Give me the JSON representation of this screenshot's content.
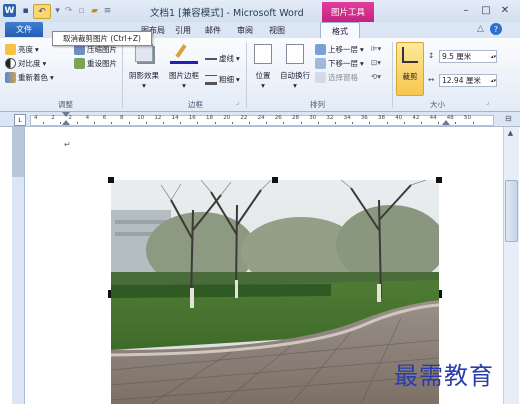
{
  "titlebar": {
    "title": "文档1 [兼容模式] - Microsoft Word",
    "context_group": "图片工具",
    "app_icon": "W"
  },
  "tabs": {
    "file": "文件",
    "items": [
      "图布局",
      "引用",
      "邮件",
      "审阅",
      "视图"
    ],
    "format": "格式"
  },
  "tooltip": "取消裁剪图片 (Ctrl+Z)",
  "ribbon": {
    "adjust": {
      "brightness": "亮度",
      "contrast": "对比度",
      "recolor": "重新着色",
      "compress": "压缩图片",
      "reset": "重设图片",
      "label": "调整"
    },
    "styles": {
      "shadow": "阴影效果",
      "border": "图片边框",
      "dashes": "虚线",
      "weight": "粗细",
      "label": "边框"
    },
    "arrange": {
      "position": "位置",
      "wrap": "自动换行",
      "bring_forward": "上移一层",
      "send_backward": "下移一层",
      "selection_pane": "选择窗格",
      "label": "排列"
    },
    "size": {
      "crop": "裁剪",
      "height": "9.5 厘米",
      "width": "12.94 厘米",
      "label": "大小"
    }
  },
  "ruler": {
    "numbers": [
      "4",
      "2",
      "2",
      "4",
      "6",
      "8",
      "10",
      "12",
      "14",
      "16",
      "18",
      "20",
      "22",
      "24",
      "26",
      "28",
      "30",
      "32",
      "34",
      "36",
      "38",
      "40",
      "42",
      "44",
      "48",
      "50"
    ]
  },
  "watermark": "最需教育"
}
